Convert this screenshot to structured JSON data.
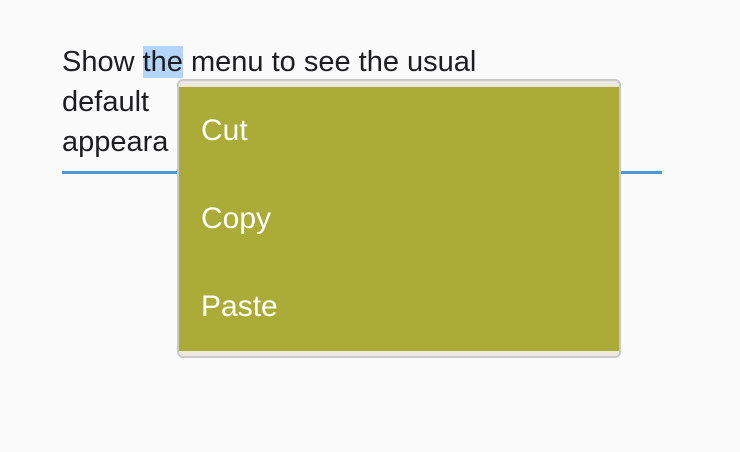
{
  "content": {
    "line1_before": "Show ",
    "line1_selected": "the",
    "line1_after": " menu to see the usual",
    "line2": "default",
    "line3": "appeara"
  },
  "context_menu": {
    "items": [
      {
        "label": "Cut"
      },
      {
        "label": "Copy"
      },
      {
        "label": "Paste"
      }
    ]
  },
  "colors": {
    "selection": "#b3d4fb",
    "menu_background": "#abab37",
    "menu_border": "#c9c9c9",
    "underline": "#4f97d8"
  }
}
